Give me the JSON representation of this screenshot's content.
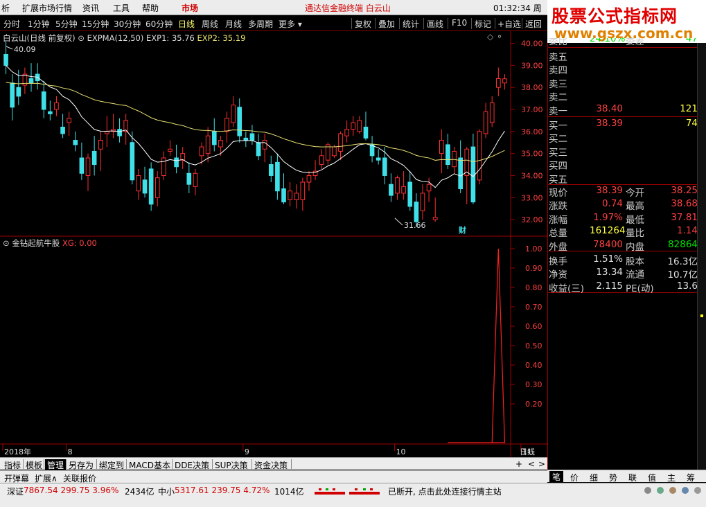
{
  "menubar": {
    "items": [
      "析",
      "扩展市场行情",
      "资讯",
      "工具",
      "帮助",
      "市场"
    ],
    "app_title": "通达信金融终端 白云山",
    "clock": "01:32:34 周日"
  },
  "toolbar": {
    "periods": [
      "分时",
      "1分钟",
      "5分钟",
      "15分钟",
      "30分钟",
      "60分钟",
      "日线",
      "周线",
      "月线",
      "多周期",
      "更多 ▾"
    ],
    "active_period": "日线",
    "actions": [
      "复权",
      "叠加",
      "统计",
      "画线",
      "F10",
      "标记",
      "+自选",
      "返回"
    ]
  },
  "main_chart": {
    "stock": "白云山(日线 前复权)",
    "indicator": "EXPMA(12,50)",
    "exp1": "EXP1: 35.76",
    "exp2": "EXP2: 35.19",
    "high_label": "40.09",
    "low_label": "31.66",
    "badge": "财"
  },
  "sub_chart": {
    "name": "金钻起航牛股",
    "value": "XG: 0.00"
  },
  "chart_data": [
    {
      "type": "candlestick",
      "ylim": [
        31.5,
        40.3
      ],
      "yticks": [
        "40.00",
        "39.00",
        "38.00",
        "37.00",
        "36.00",
        "35.00",
        "34.00",
        "33.00",
        "32.00"
      ],
      "xticks": [
        "2018年",
        "8",
        "9",
        "10",
        "11"
      ],
      "ohlc": [
        [
          39.5,
          40.09,
          38.6,
          39.0
        ],
        [
          38.2,
          38.6,
          36.5,
          37.1
        ],
        [
          38.0,
          38.8,
          37.2,
          37.6
        ],
        [
          38.1,
          38.9,
          37.7,
          38.6
        ],
        [
          38.4,
          39.1,
          37.8,
          38.2
        ],
        [
          38.6,
          39.1,
          37.9,
          38.3
        ],
        [
          37.8,
          38.3,
          36.6,
          37.0
        ],
        [
          36.9,
          37.4,
          36.5,
          36.8
        ],
        [
          37.0,
          37.6,
          36.7,
          37.3
        ],
        [
          36.2,
          36.8,
          35.7,
          35.9
        ],
        [
          36.4,
          36.9,
          35.8,
          36.6
        ],
        [
          35.6,
          36.0,
          35.1,
          35.4
        ],
        [
          34.8,
          35.5,
          33.8,
          34.1
        ],
        [
          34.0,
          35.0,
          33.3,
          34.8
        ],
        [
          35.1,
          35.8,
          34.0,
          34.5
        ],
        [
          35.2,
          36.0,
          34.2,
          35.6
        ],
        [
          35.9,
          36.7,
          35.3,
          36.0
        ],
        [
          36.0,
          36.8,
          35.7,
          36.1
        ],
        [
          36.1,
          36.6,
          35.5,
          35.8
        ],
        [
          36.0,
          36.8,
          35.4,
          36.5
        ],
        [
          35.5,
          36.0,
          33.6,
          33.8
        ],
        [
          33.3,
          34.3,
          32.9,
          34.0
        ],
        [
          33.8,
          34.4,
          33.0,
          33.2
        ],
        [
          34.3,
          34.6,
          32.4,
          32.7
        ],
        [
          33.0,
          34.2,
          32.6,
          33.9
        ],
        [
          34.0,
          35.1,
          33.8,
          34.8
        ],
        [
          35.1,
          35.6,
          34.9,
          35.2
        ],
        [
          34.8,
          35.4,
          34.1,
          34.4
        ],
        [
          34.7,
          35.3,
          34.3,
          35.0
        ],
        [
          34.1,
          34.6,
          33.2,
          33.6
        ],
        [
          33.5,
          34.3,
          33.1,
          34.1
        ],
        [
          34.9,
          35.5,
          34.5,
          35.3
        ],
        [
          35.0,
          36.2,
          34.6,
          35.8
        ],
        [
          36.0,
          36.6,
          35.1,
          35.4
        ],
        [
          35.3,
          35.8,
          34.9,
          35.6
        ],
        [
          36.0,
          36.9,
          35.5,
          36.6
        ],
        [
          36.4,
          37.6,
          36.2,
          37.2
        ],
        [
          37.1,
          37.5,
          35.5,
          35.8
        ],
        [
          35.7,
          36.0,
          35.3,
          35.6
        ],
        [
          35.9,
          36.3,
          35.4,
          35.6
        ],
        [
          35.5,
          35.9,
          34.7,
          34.9
        ],
        [
          35.2,
          35.9,
          34.6,
          35.6
        ],
        [
          34.5,
          34.9,
          33.7,
          34.0
        ],
        [
          34.6,
          35.0,
          32.9,
          33.3
        ],
        [
          33.4,
          34.1,
          32.7,
          32.8
        ],
        [
          32.9,
          33.7,
          32.6,
          33.3
        ],
        [
          32.9,
          33.6,
          32.5,
          33.2
        ],
        [
          32.9,
          33.9,
          32.4,
          33.7
        ],
        [
          33.7,
          34.2,
          33.3,
          34.0
        ],
        [
          34.0,
          34.7,
          33.8,
          34.2
        ],
        [
          34.5,
          35.2,
          34.3,
          34.9
        ],
        [
          34.7,
          35.5,
          34.5,
          35.4
        ],
        [
          34.9,
          35.4,
          34.8,
          35.3
        ],
        [
          35.1,
          36.0,
          34.7,
          35.9
        ],
        [
          35.8,
          36.5,
          35.5,
          36.1
        ],
        [
          36.1,
          36.7,
          35.8,
          36.4
        ],
        [
          36.0,
          36.7,
          35.9,
          36.5
        ],
        [
          36.2,
          36.9,
          35.6,
          35.7
        ],
        [
          35.4,
          35.8,
          34.6,
          34.9
        ],
        [
          34.8,
          35.2,
          34.5,
          34.7
        ],
        [
          34.8,
          35.3,
          33.6,
          34.0
        ],
        [
          33.6,
          34.1,
          32.8,
          33.1
        ],
        [
          33.2,
          34.0,
          32.9,
          33.9
        ],
        [
          33.2,
          34.2,
          32.9,
          33.5
        ],
        [
          33.7,
          34.2,
          32.4,
          32.6
        ],
        [
          32.8,
          33.2,
          31.66,
          31.9
        ],
        [
          32.4,
          33.6,
          32.0,
          33.2
        ],
        [
          33.3,
          33.9,
          32.8,
          33.6
        ],
        [
          32.0,
          33.0,
          31.9,
          32.1
        ],
        [
          35.0,
          36.1,
          34.1,
          35.6
        ],
        [
          35.4,
          35.9,
          34.3,
          34.5
        ],
        [
          34.4,
          35.3,
          34.1,
          35.1
        ],
        [
          34.8,
          35.6,
          33.2,
          33.4
        ],
        [
          34.0,
          35.3,
          32.7,
          35.2
        ],
        [
          35.3,
          35.9,
          32.7,
          32.8
        ],
        [
          33.8,
          36.1,
          33.6,
          36.0
        ],
        [
          35.9,
          37.3,
          35.7,
          36.9
        ],
        [
          36.4,
          37.6,
          36.2,
          37.3
        ],
        [
          38.0,
          38.9,
          37.6,
          38.4
        ],
        [
          38.2,
          38.6,
          37.9,
          38.39
        ]
      ]
    },
    {
      "type": "line",
      "ylim": [
        0,
        1.05
      ],
      "yticks": [
        "1.00",
        "0.90",
        "0.80",
        "0.70",
        "0.60",
        "0.50",
        "0.40",
        "0.30",
        "0.20"
      ],
      "spike_at_index": 78,
      "spike_value": 1.0
    }
  ],
  "x_axis_label": "日线",
  "quote": {
    "top_row": [
      "委比",
      "24.10%",
      "委差",
      "47"
    ],
    "sell": [
      {
        "label": "卖五",
        "price": "",
        "vol": ""
      },
      {
        "label": "卖四",
        "price": "",
        "vol": ""
      },
      {
        "label": "卖三",
        "price": "",
        "vol": ""
      },
      {
        "label": "卖二",
        "price": "",
        "vol": ""
      },
      {
        "label": "卖一",
        "price": "38.40",
        "vol": "121"
      }
    ],
    "buy": [
      {
        "label": "买一",
        "price": "38.39",
        "vol": "74"
      },
      {
        "label": "买二",
        "price": "",
        "vol": ""
      },
      {
        "label": "买三",
        "price": "",
        "vol": ""
      },
      {
        "label": "买四",
        "price": "",
        "vol": ""
      },
      {
        "label": "买五",
        "price": "",
        "vol": ""
      }
    ],
    "stats": [
      {
        "l1": "现价",
        "v1": "38.39",
        "c1": "red",
        "l2": "今开",
        "v2": "38.25",
        "c2": "red"
      },
      {
        "l1": "涨跌",
        "v1": "0.74",
        "c1": "red",
        "l2": "最高",
        "v2": "38.68",
        "c2": "red"
      },
      {
        "l1": "涨幅",
        "v1": "1.97%",
        "c1": "red",
        "l2": "最低",
        "v2": "37.81",
        "c2": "red"
      },
      {
        "l1": "总量",
        "v1": "161264",
        "c1": "yellow",
        "l2": "量比",
        "v2": "1.14",
        "c2": "red"
      },
      {
        "l1": "外盘",
        "v1": "78400",
        "c1": "red",
        "l2": "内盘",
        "v2": "82864",
        "c2": "green"
      },
      {
        "l1": "换手",
        "v1": "1.51%",
        "c1": "white",
        "l2": "股本",
        "v2": "16.3亿",
        "c2": "white"
      },
      {
        "l1": "净资",
        "v1": "13.34",
        "c1": "white",
        "l2": "流通",
        "v2": "10.7亿",
        "c2": "white"
      },
      {
        "l1": "收益(三)",
        "v1": "2.115",
        "c1": "white",
        "l2": "PE(动)",
        "v2": "13.6",
        "c2": "white"
      }
    ]
  },
  "watermark": {
    "line1": "股票公式指标网",
    "line2": "www.gszx.com.cn"
  },
  "right_tabs": [
    "笔",
    "价",
    "细",
    "势",
    "联",
    "值",
    "主",
    "筹"
  ],
  "bottom_tabs": [
    "指标",
    "模板",
    "管理",
    "另存为",
    "绑定到",
    "MACD基本",
    "DDE决策",
    "SUP决策",
    "资金决策"
  ],
  "bottom_tabs_active": "管理",
  "bottom_tabs_extra": [
    "+",
    "<",
    ">"
  ],
  "bottom_tabs2": [
    "开弹幕",
    "扩展∧",
    "关联报价"
  ],
  "status": {
    "sz_label": "深证",
    "sz_values": "7867.54  299.75  3.96%",
    "sz_amount": "2434亿",
    "zx_label": "中小",
    "zx_values": "5317.61  239.75  4.72%",
    "zx_amount": "1014亿",
    "message": "已断开, 点击此处连接行情主站"
  },
  "colors": {
    "up": "#ff3030",
    "down": "#40e0e8",
    "exp1": "#ffffff",
    "exp2": "#e8e070",
    "grid": "#a00000",
    "signal": "#ff2020"
  }
}
